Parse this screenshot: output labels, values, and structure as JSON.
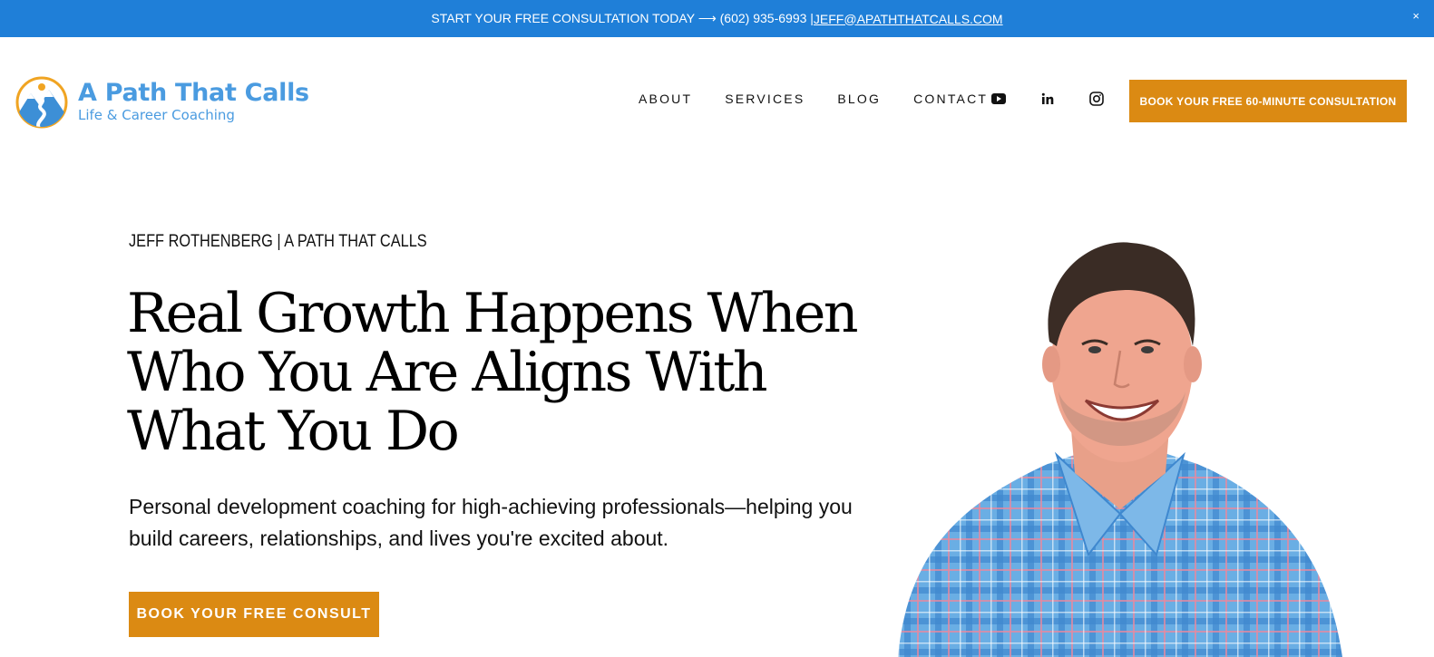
{
  "announcement": {
    "text": "START YOUR FREE CONSULTATION TODAY ⟶ (602) 935-6993 | ",
    "email": "JEFF@APATHTHATCALLS.COM",
    "close": "×"
  },
  "logo": {
    "title": "A Path That Calls",
    "subtitle": "Life & Career Coaching",
    "icon": "mountain-path-logo-icon"
  },
  "nav": {
    "items": [
      "ABOUT",
      "SERVICES",
      "BLOG",
      "CONTACT"
    ]
  },
  "social": {
    "icons": [
      "youtube-icon",
      "linkedin-icon",
      "instagram-icon"
    ]
  },
  "header_cta": "BOOK YOUR FREE 60-MINUTE CONSULTATION",
  "hero": {
    "eyebrow": "JEFF ROTHENBERG | A PATH THAT CALLS",
    "headline": "Real Growth Happens When Who You Are Aligns With What You Do",
    "subtext": "Personal development coaching for high-achieving professionals—helping you build careers, relationships, and lives you're excited about.",
    "cta": "BOOK YOUR FREE CONSULT"
  },
  "colors": {
    "announcement_bg": "#1f7fd8",
    "accent": "#db8a13",
    "logo_blue": "#4a9be0",
    "shirt_blue": "#5da2dc"
  }
}
